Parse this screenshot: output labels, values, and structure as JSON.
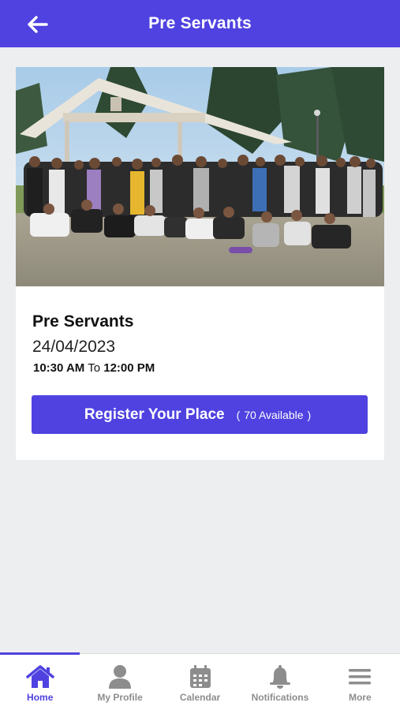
{
  "header": {
    "title": "Pre Servants"
  },
  "event": {
    "title": "Pre Servants",
    "date": "24/04/2023",
    "start_time": "10:30 AM",
    "time_separator": "To",
    "end_time": "12:00 PM",
    "register_label": "Register Your Place",
    "available_text": "70 Available"
  },
  "tabs": [
    {
      "label": "Home",
      "icon": "home-icon",
      "active": true
    },
    {
      "label": "My Profile",
      "icon": "person-icon",
      "active": false
    },
    {
      "label": "Calendar",
      "icon": "calendar-icon",
      "active": false
    },
    {
      "label": "Notifications",
      "icon": "bell-icon",
      "active": false
    },
    {
      "label": "More",
      "icon": "menu-icon",
      "active": false
    }
  ],
  "colors": {
    "accent": "#4f42e0",
    "inactive": "#8d8d8d",
    "background": "#edeeef"
  }
}
